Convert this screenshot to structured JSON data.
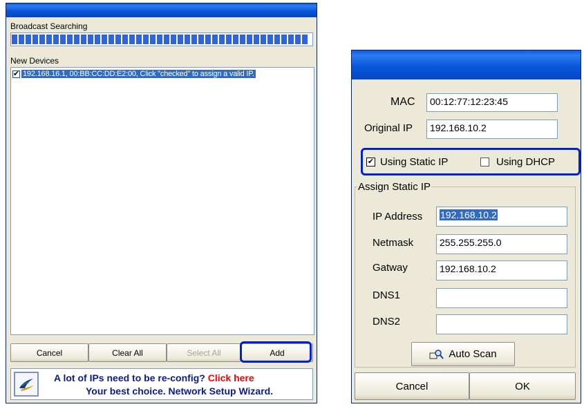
{
  "left_window": {
    "broadcast_label": "Broadcast Searching",
    "progress_percent": 100,
    "new_devices_label": "New Devices",
    "device_item": "192.168.16.1, 00:BB:CC:DD:E2:00, Click \"checked\" to assign a valid IP.",
    "device_checked": true,
    "buttons": {
      "cancel": "Cancel",
      "clear_all": "Clear All",
      "select_all": "Select All",
      "add": "Add"
    },
    "banner": {
      "question": "A lot of IPs need to be re-config?",
      "link": "Click here",
      "tagline": "Your best choice. Network Setup Wizard."
    }
  },
  "right_window": {
    "mac_label": "MAC",
    "mac_value": "00:12:77:12:23:45",
    "original_ip_label": "Original IP",
    "original_ip_value": "192.168.10.2",
    "static_ip_label": "Using Static IP",
    "static_checked": true,
    "dhcp_label": "Using DHCP",
    "dhcp_checked": false,
    "group_title": "Assign Static IP",
    "ip_address_label": "IP Address",
    "ip_address_value": "192.168.10.2",
    "netmask_label": "Netmask",
    "netmask_value": "255.255.255.0",
    "gateway_label": "Gatway",
    "gateway_value": "192.168.10.2",
    "dns1_label": "DNS1",
    "dns1_value": "",
    "dns2_label": "DNS2",
    "dns2_value": "",
    "auto_scan_label": "Auto Scan",
    "cancel_label": "Cancel",
    "ok_label": "OK"
  },
  "colors": {
    "highlight": "#0022cc",
    "title_blue": "#0857d8",
    "link_red": "#ff0000",
    "selection": "#316ac5"
  }
}
